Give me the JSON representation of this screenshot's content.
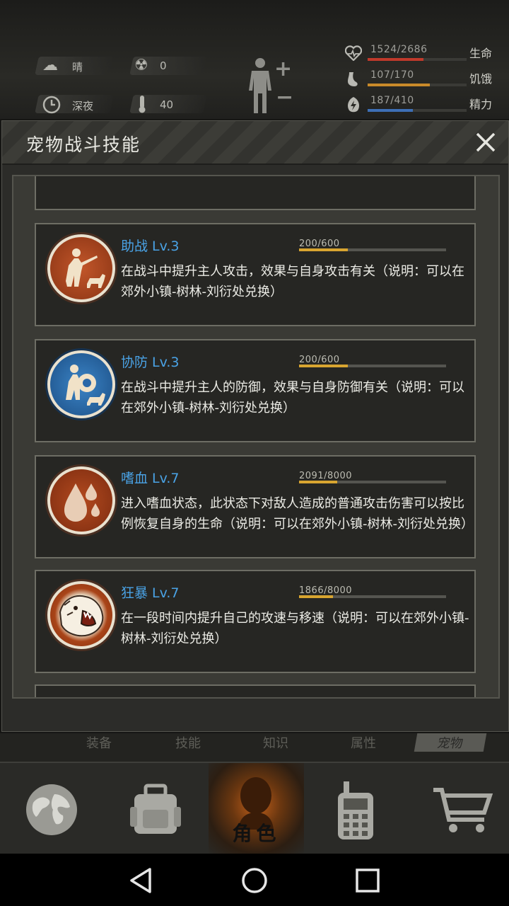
{
  "status": {
    "weather": "晴",
    "radiation": "0",
    "time_of_day": "深夜",
    "temperature": "40",
    "bars": [
      {
        "id": "life",
        "icon": "heart-icon",
        "value": "1524/2686",
        "label": "生命",
        "color": "#c0392b",
        "level": 0.567
      },
      {
        "id": "hunger",
        "icon": "stomach-icon",
        "value": "107/170",
        "label": "饥饿",
        "color": "#c98a2a",
        "level": 0.629
      },
      {
        "id": "energy",
        "icon": "energy-icon",
        "value": "187/410",
        "label": "精力",
        "color": "#3d6fb5",
        "level": 0.456
      }
    ]
  },
  "panel": {
    "title": "宠物战斗技能",
    "close_label": "✕"
  },
  "skills": [
    {
      "name": "助战 Lv.3",
      "xp_text": "200/600",
      "xp_level": 0.333,
      "desc": "在战斗中提升主人攻击，效果与自身攻击有关（说明：可以在郊外小镇-树林-刘衍处兑换）",
      "icon": "hunter-dog-icon",
      "bg": "#a8451e"
    },
    {
      "name": "协防 Lv.3",
      "xp_text": "200/600",
      "xp_level": 0.333,
      "desc": "在战斗中提升主人的防御，效果与自身防御有关（说明：可以在郊外小镇-树林-刘衍处兑换）",
      "icon": "shield-dog-icon",
      "bg": "#2467a8"
    },
    {
      "name": "嗜血 Lv.7",
      "xp_text": "2091/8000",
      "xp_level": 0.261,
      "desc": "进入嗜血状态，此状态下对敌人造成的普通攻击伤害可以按比例恢复自身的生命（说明：可以在郊外小镇-树林-刘衍处兑换）",
      "icon": "blood-drops-icon",
      "bg": "#9c3b17"
    },
    {
      "name": "狂暴 Lv.7",
      "xp_text": "1866/8000",
      "xp_level": 0.233,
      "desc": "在一段时间内提升自己的攻速与移速（说明：可以在郊外小镇-树林-刘衍处兑换）",
      "icon": "roaring-beast-icon",
      "bg": "#9c3b17"
    }
  ],
  "tabs": [
    "装备",
    "技能",
    "知识",
    "属性",
    "宠物"
  ],
  "nav": {
    "items": [
      "globe-icon",
      "backpack-icon",
      "character-icon",
      "radio-icon",
      "cart-icon"
    ],
    "character_label": "角色"
  }
}
